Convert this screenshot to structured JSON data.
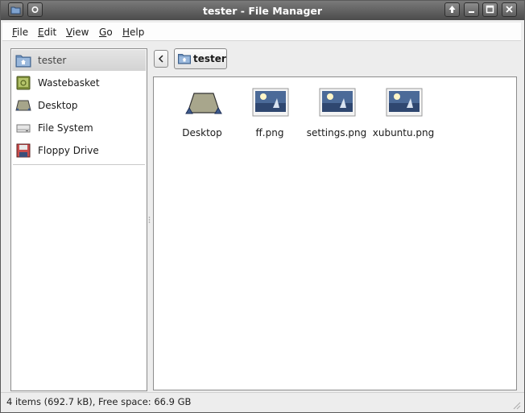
{
  "window": {
    "title": "tester - File Manager",
    "app_icon": "file-manager-icon",
    "controls": [
      "menu-icon",
      "shade-icon",
      "minimize-icon",
      "maximize-icon",
      "close-icon"
    ]
  },
  "menubar": {
    "file": {
      "accel": "F",
      "rest": "ile"
    },
    "edit": {
      "accel": "E",
      "rest": "dit"
    },
    "view": {
      "accel": "V",
      "rest": "iew"
    },
    "go": {
      "accel": "G",
      "rest": "o"
    },
    "help": {
      "accel": "H",
      "rest": "elp"
    }
  },
  "sidepane": {
    "items": [
      {
        "label": "tester",
        "icon": "home-folder-icon",
        "selected": true
      },
      {
        "label": "Wastebasket",
        "icon": "trash-icon"
      },
      {
        "label": "Desktop",
        "icon": "desktop-icon"
      },
      {
        "label": "File System",
        "icon": "harddisk-icon"
      },
      {
        "label": "Floppy Drive",
        "icon": "floppy-icon"
      }
    ]
  },
  "pathbar": {
    "back_icon": "chevron-left-icon",
    "current": "tester"
  },
  "files": [
    {
      "name": "Desktop",
      "icon": "desktop-icon"
    },
    {
      "name": "ff.png",
      "icon": "image-icon"
    },
    {
      "name": "settings.png",
      "icon": "image-icon"
    },
    {
      "name": "xubuntu.png",
      "icon": "image-icon"
    }
  ],
  "statusbar": {
    "text": "4 items (692.7 kB), Free space: 66.9 GB"
  },
  "colors": {
    "titlebar": "#5e5e5e",
    "selection": "#d8d8d8",
    "folder_blue": "#6f93bf"
  }
}
